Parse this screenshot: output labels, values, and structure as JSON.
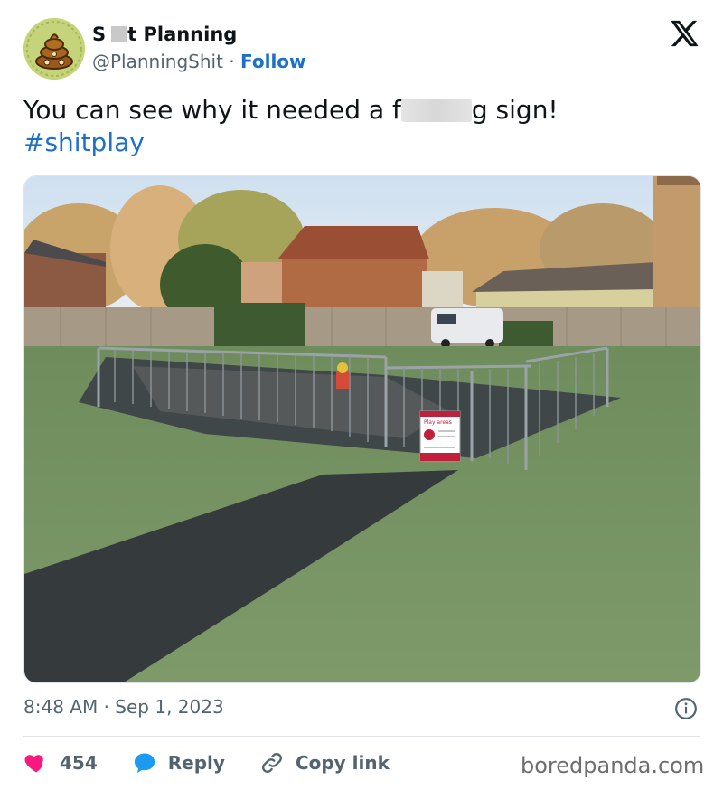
{
  "author": {
    "name_start": "S",
    "name_end": "t Planning",
    "handle": "@PlanningShit",
    "separator": "·",
    "follow_label": "Follow"
  },
  "tweet": {
    "text_before": "You can see why it needed a f",
    "text_after": "g sign!",
    "hashtag": "#shitplay"
  },
  "photo": {
    "sign_title": "Play areas"
  },
  "meta": {
    "time": "8:48 AM",
    "separator": "·",
    "date": "Sep 1, 2023"
  },
  "actions": {
    "like_count": "454",
    "reply_label": "Reply",
    "copy_label": "Copy link"
  },
  "watermark": "boredpanda.com",
  "colors": {
    "link_blue": "#1d70c9",
    "heart_pink": "#f91880",
    "reply_blue": "#1d9bf0"
  },
  "icons": [
    "poop-avatar-icon",
    "x-logo-icon",
    "info-icon",
    "heart-icon",
    "reply-bubble-icon",
    "link-icon"
  ]
}
